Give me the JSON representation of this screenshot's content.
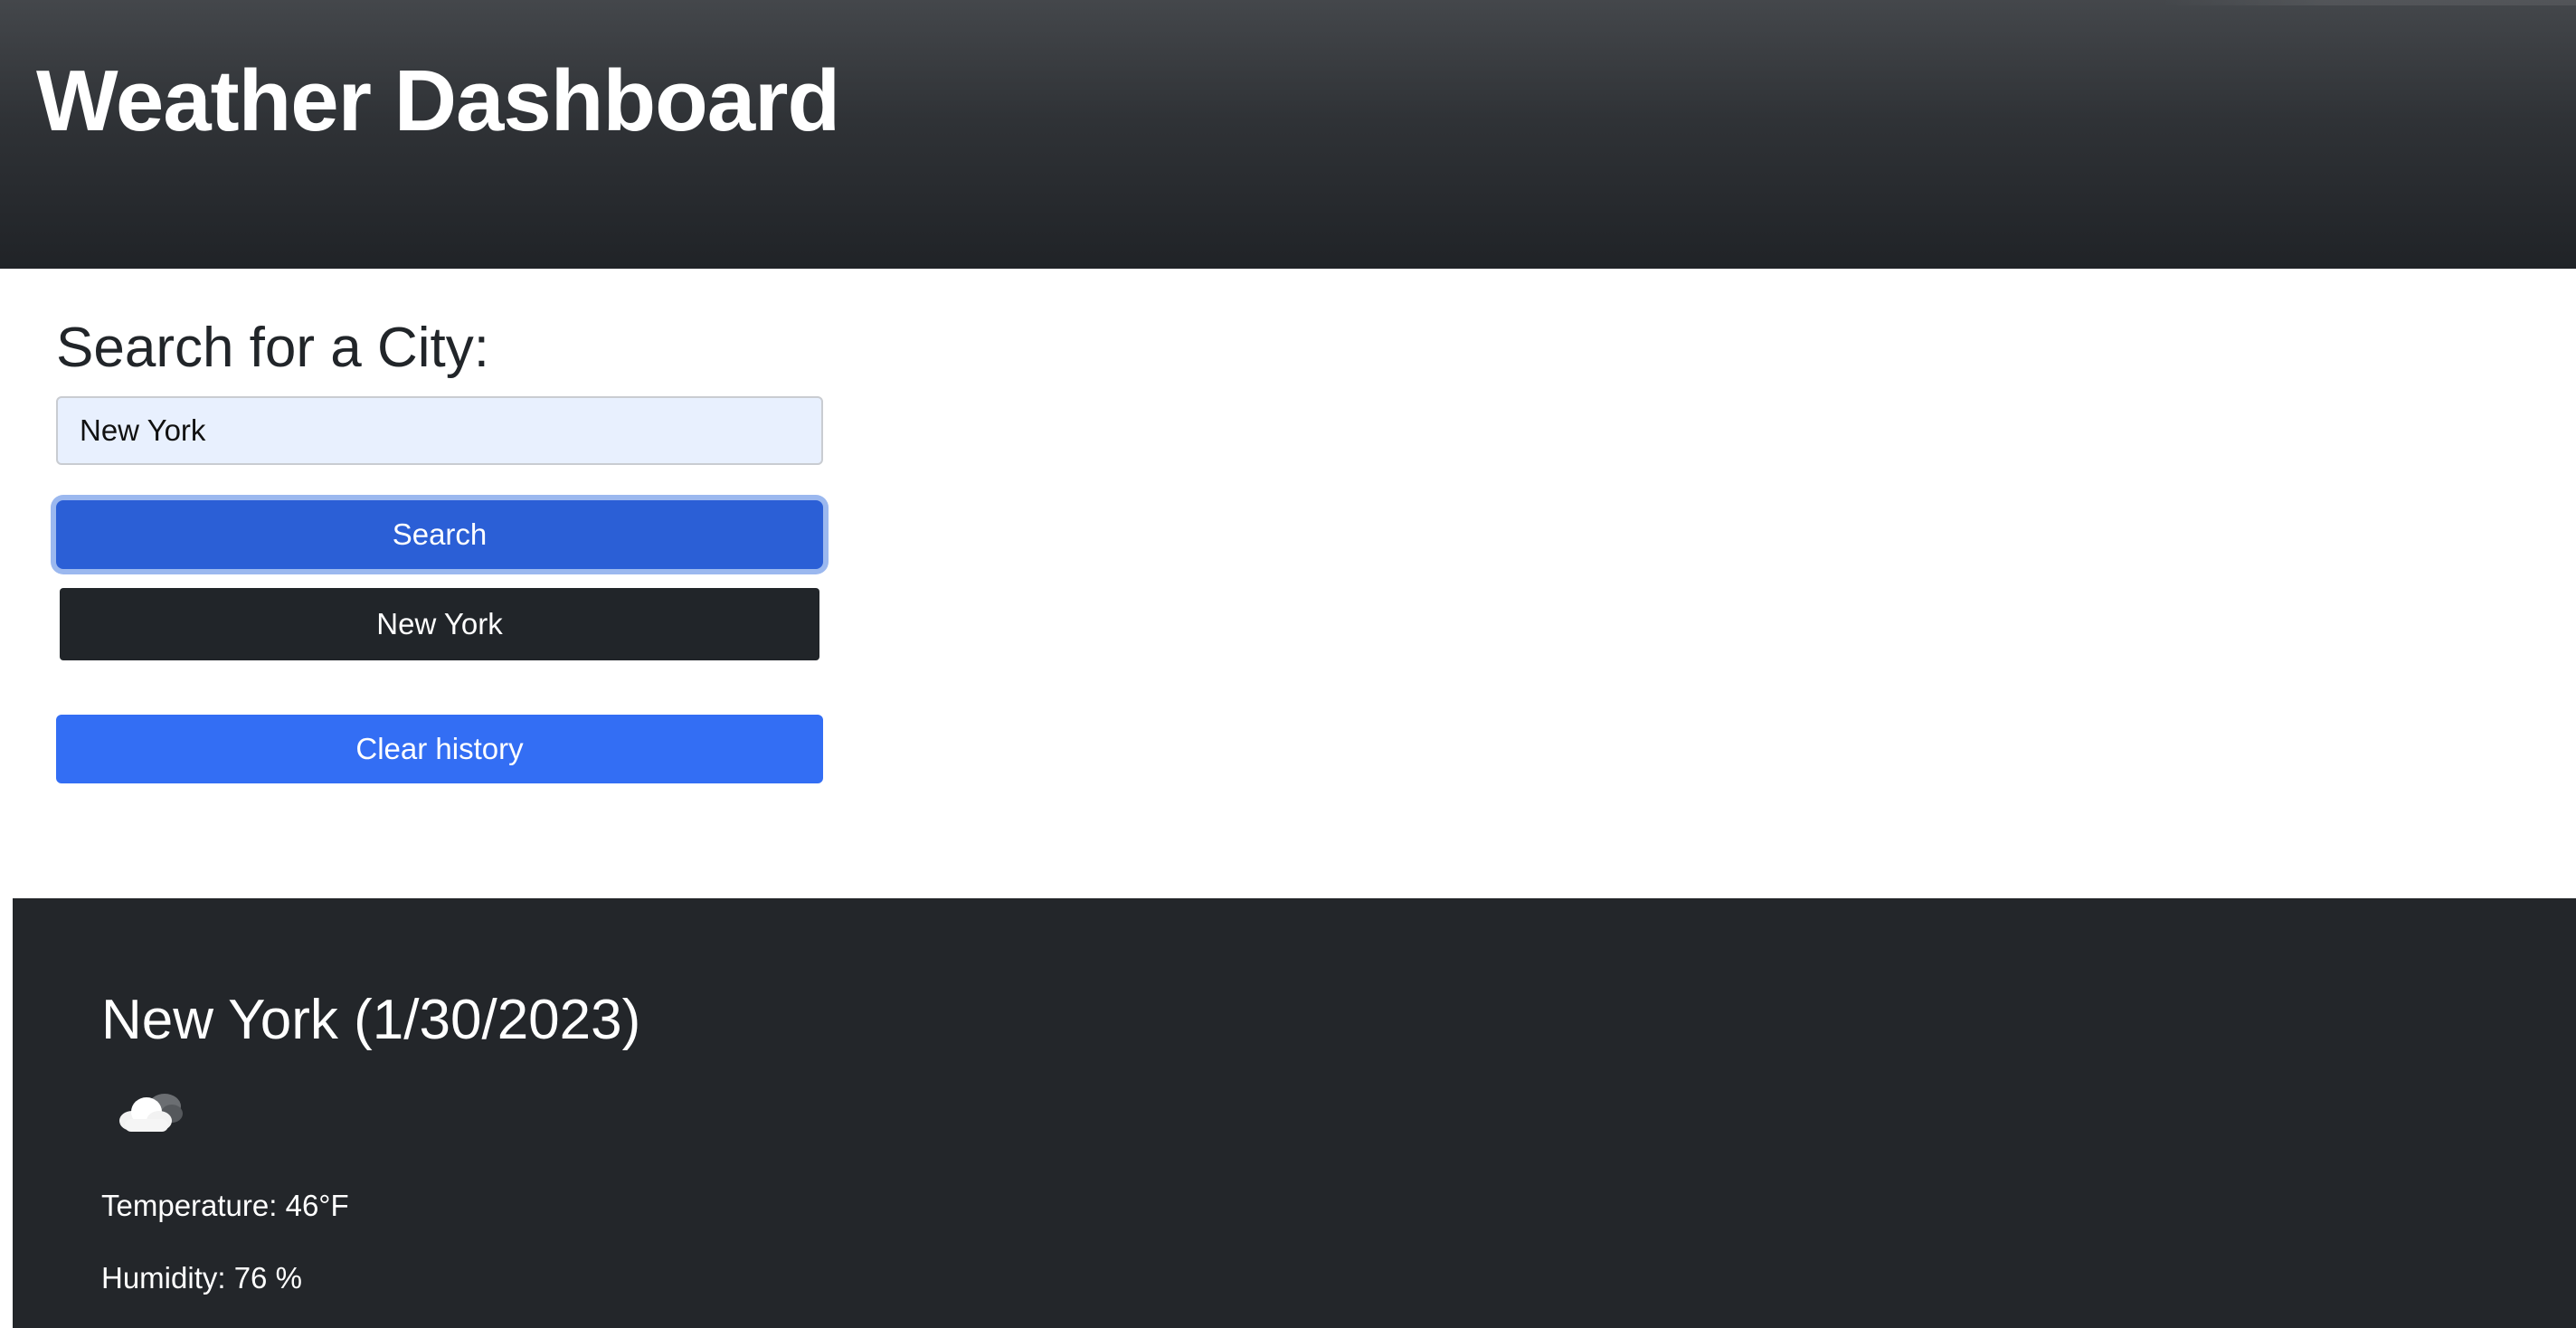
{
  "header": {
    "title": "Weather Dashboard"
  },
  "search": {
    "heading": "Search for a City:",
    "input_value": "New York",
    "button_label": "Search"
  },
  "history": {
    "items": [
      {
        "label": "New York"
      }
    ],
    "clear_label": "Clear history"
  },
  "current": {
    "title": "New York (1/30/2023)",
    "icon": "cloud-icon",
    "temperature": "Temperature: 46°F",
    "humidity": "Humidity: 76 %"
  },
  "colors": {
    "header_bg": "#2f3236",
    "search_button": "#2b5fd6",
    "history_button": "#212529",
    "clear_button": "#336ef4",
    "panel_bg": "#23262a",
    "input_bg": "#e8f0fe"
  }
}
